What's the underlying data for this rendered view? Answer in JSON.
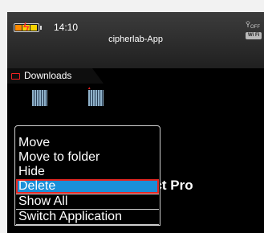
{
  "status_bar": {
    "time": "14:10",
    "app_title": "cipherlab-App",
    "signal_label": "OFF",
    "wifi_label": "Wi Fi"
  },
  "tabs": [
    {
      "label": "Downloads"
    }
  ],
  "background_text": "ect Pro",
  "context_menu": {
    "items": [
      {
        "label": "Move"
      },
      {
        "label": "Move to folder"
      },
      {
        "label": "Hide"
      },
      {
        "label": "Delete",
        "selected": true
      },
      {
        "label": "Show All"
      },
      {
        "label": "Switch Application"
      }
    ]
  },
  "colors": {
    "highlight": "#1a8fd8",
    "highlight_border": "#e52521"
  }
}
